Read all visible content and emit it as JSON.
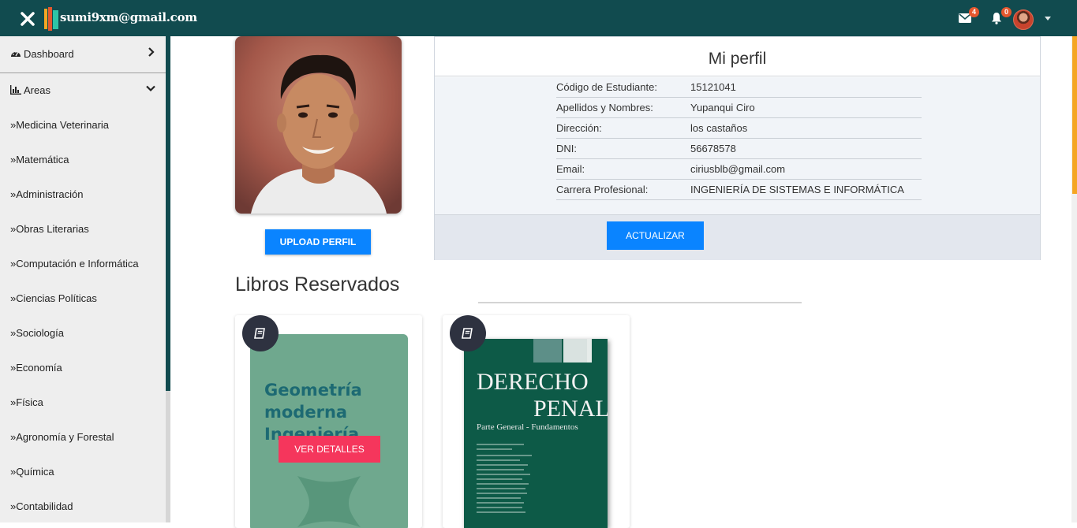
{
  "topbar": {
    "brand_text": "sumi9xm@gmail.com",
    "mail_count": "4",
    "notification_count": "0"
  },
  "sidebar": {
    "dashboard_label": "Dashboard",
    "areas_label": "Areas",
    "items": [
      "»Medicina Veterinaria",
      "»Matemática",
      "»Administración",
      "»Obras Literarias",
      "»Computación e Informática",
      "»Ciencias Políticas",
      "»Sociología",
      "»Economía",
      "»Física",
      "»Agronomía y Forestal",
      "»Química",
      "»Contabilidad"
    ]
  },
  "profile": {
    "upload_label": "UPLOAD PERFIL",
    "title": "Mi perfil",
    "fields": [
      {
        "label": "Código de Estudiante:",
        "value": "15121041"
      },
      {
        "label": "Apellidos y Nombres:",
        "value": "Yupanqui Ciro"
      },
      {
        "label": "Dirección:",
        "value": "los castaños"
      },
      {
        "label": "DNI:",
        "value": "56678578"
      },
      {
        "label": "Email:",
        "value": "ciriusblb@gmail.com"
      },
      {
        "label": "Carrera Profesional:",
        "value": "INGENIERÍA DE SISTEMAS E INFORMÁTICA"
      }
    ],
    "update_label": "ACTUALIZAR"
  },
  "books": {
    "section_title": "Libros Reservados",
    "details_label": "VER DETALLES",
    "items": [
      {
        "cover_title": "Geometría\nmoderna\nIngeniería"
      },
      {
        "cover_line1": "DERECHO",
        "cover_line2": "PENAL",
        "cover_subtitle": "Parte General - Fundamentos"
      }
    ]
  },
  "colors": {
    "topbar": "#114b4f",
    "primary_button": "#0a84ff",
    "details_button": "#f5365c",
    "badge": "#e4572e"
  }
}
